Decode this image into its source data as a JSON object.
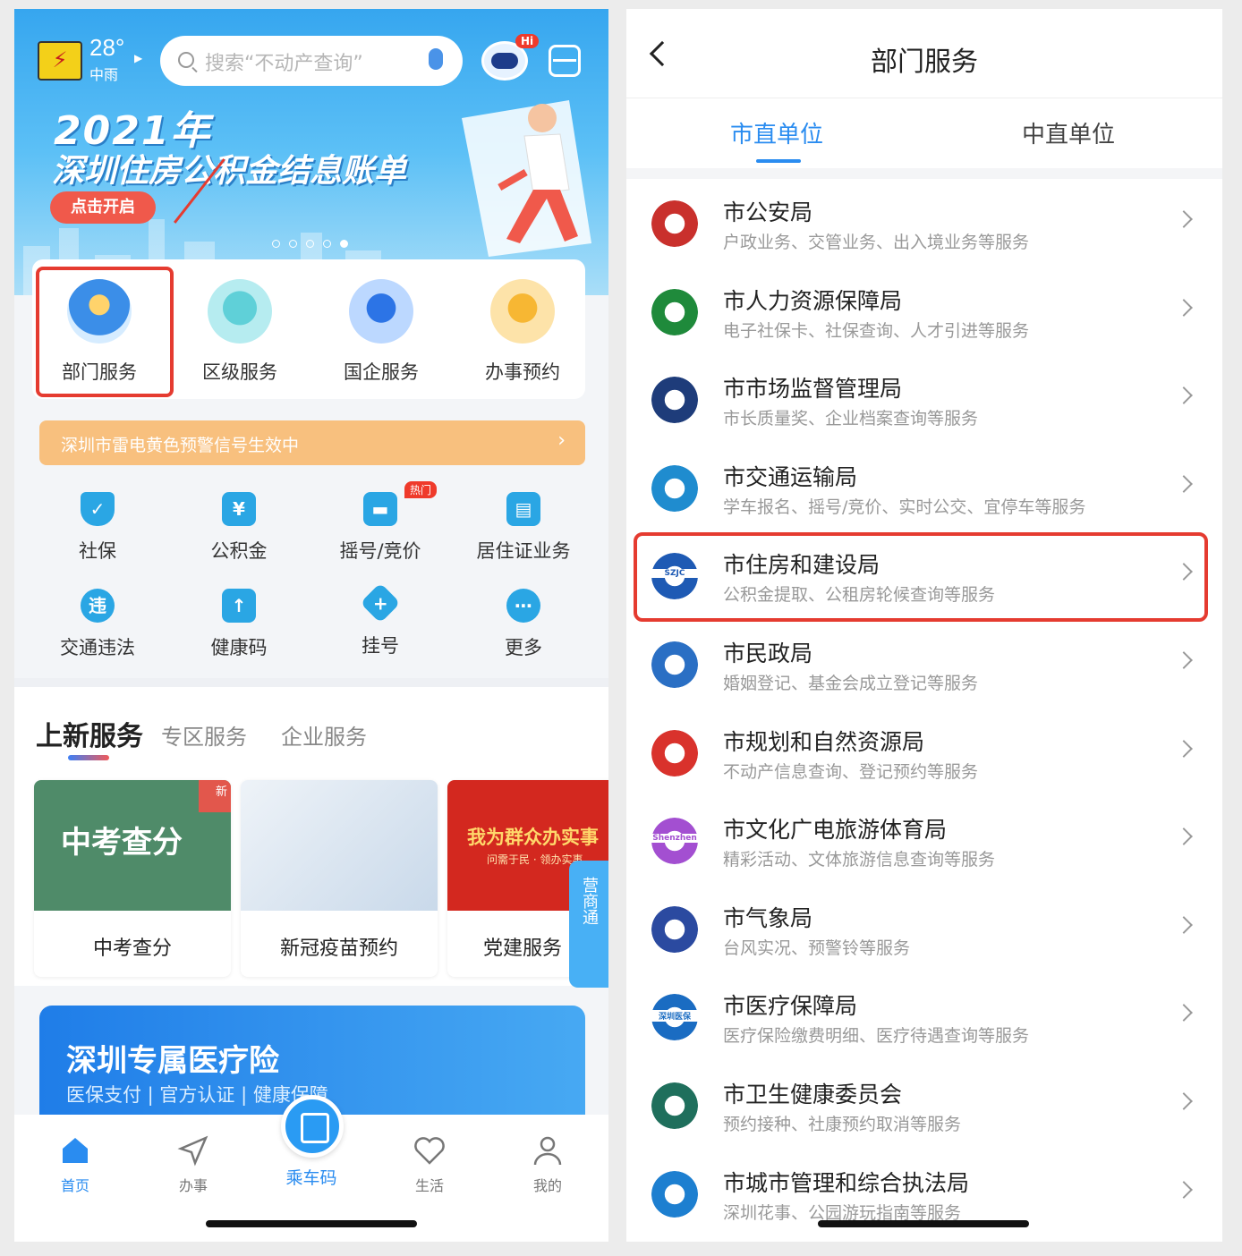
{
  "left": {
    "weather": {
      "temp": "28°",
      "desc": "中雨"
    },
    "search_placeholder": "搜索“不动产查询”",
    "robot_badge": "Hi",
    "banner": {
      "year": "2021年",
      "title": "深圳住房公积金结息账单",
      "button": "点击开启",
      "active_dot": 5
    },
    "services": [
      "部门服务",
      "区级服务",
      "国企服务",
      "办事预约"
    ],
    "warning": "深圳市雷电黄色预警信号生效中",
    "grid": [
      {
        "label": "社保",
        "icon": "shield-icon"
      },
      {
        "label": "公积金",
        "icon": "house-yen-icon"
      },
      {
        "label": "摇号/竞价",
        "icon": "car-icon"
      },
      {
        "label": "居住证业务",
        "icon": "id-card-icon"
      },
      {
        "label": "交通违法",
        "icon": "violation-icon"
      },
      {
        "label": "健康码",
        "icon": "health-code-icon"
      },
      {
        "label": "挂号",
        "icon": "plus-diamond-icon"
      },
      {
        "label": "更多",
        "icon": "more-icon"
      }
    ],
    "hot_badge": "热门",
    "section_tabs": [
      "上新服务",
      "专区服务",
      "企业服务"
    ],
    "cards": [
      {
        "label": "中考查分",
        "image_text": "中考查分",
        "badge": "新"
      },
      {
        "label": "新冠疫苗预约"
      },
      {
        "label": "党建服务",
        "image_text": "我为群众办实事",
        "image_sub": "问需于民 · 领办实事"
      }
    ],
    "ribbon": "营商通",
    "promo": {
      "title": "深圳专属医疗险",
      "subtitle": "医保支付 | 官方认证 | 健康保障"
    },
    "tabbar": [
      "首页",
      "办事",
      "乘车码",
      "生活",
      "我的"
    ]
  },
  "right": {
    "title": "部门服务",
    "tabs": [
      "市直单位",
      "中直单位"
    ],
    "departments": [
      {
        "name": "市公安局",
        "desc": "户政业务、交管业务、出入境业务等服务",
        "color": "#c9302c"
      },
      {
        "name": "市人力资源保障局",
        "desc": "电子社保卡、社保查询、人才引进等服务",
        "color": "#1f8a3b"
      },
      {
        "name": "市市场监督管理局",
        "desc": "市长质量奖、企业档案查询等服务",
        "color": "#1e3c7a"
      },
      {
        "name": "市交通运输局",
        "desc": "学车报名、摇号/竞价、实时公交、宜停车等服务",
        "color": "#1f8ccf"
      },
      {
        "name": "市住房和建设局",
        "desc": "公积金提取、公租房轮候查询等服务",
        "color": "#1e5ab4",
        "logo_text": "SZJC"
      },
      {
        "name": "市民政局",
        "desc": "婚姻登记、基金会成立登记等服务",
        "color": "#2a6fc4"
      },
      {
        "name": "市规划和自然资源局",
        "desc": "不动产信息查询、登记预约等服务",
        "color": "#d9322c"
      },
      {
        "name": "市文化广电旅游体育局",
        "desc": "精彩活动、文体旅游信息查询等服务",
        "color": "#a34fd1",
        "logo_text": "Shenzhen"
      },
      {
        "name": "市气象局",
        "desc": "台风实况、预警铃等服务",
        "color": "#2b4aa0"
      },
      {
        "name": "市医疗保障局",
        "desc": "医疗保险缴费明细、医疗待遇查询等服务",
        "color": "#1a6cc2",
        "logo_text": "深圳医保"
      },
      {
        "name": "市卫生健康委员会",
        "desc": "预约接种、社康预约取消等服务",
        "color": "#1f6f5c"
      },
      {
        "name": "市城市管理和综合执法局",
        "desc": "深圳花事、公园游玩指南等服务",
        "color": "#1d7fd0"
      }
    ]
  }
}
